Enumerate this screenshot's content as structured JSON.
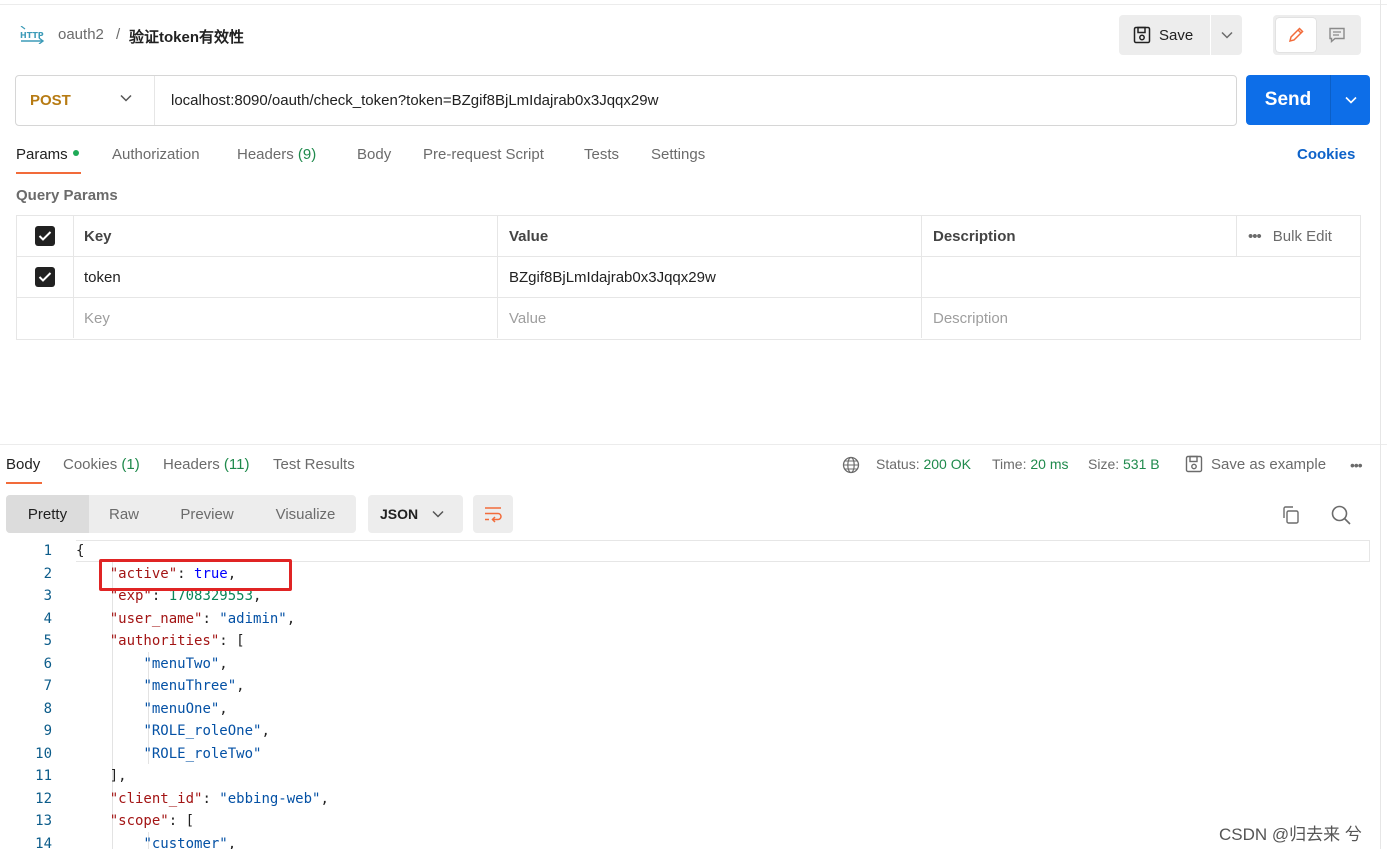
{
  "breadcrumb": {
    "collection": "oauth2",
    "separator": "/",
    "request_name": "验证token有效性"
  },
  "header": {
    "save_label": "Save"
  },
  "request": {
    "method": "POST",
    "url": "localhost:8090/oauth/check_token?token=BZgif8BjLmIdajrab0x3Jqqx29w",
    "send_label": "Send"
  },
  "req_tabs": {
    "params": "Params",
    "authorization": "Authorization",
    "headers": "Headers",
    "headers_count": "(9)",
    "body": "Body",
    "prerequest": "Pre-request Script",
    "tests": "Tests",
    "settings": "Settings",
    "cookies": "Cookies"
  },
  "query_params": {
    "title": "Query Params",
    "headers": {
      "key": "Key",
      "value": "Value",
      "description": "Description",
      "bulk_edit": "Bulk Edit"
    },
    "rows": [
      {
        "key": "token",
        "value": "BZgif8BjLmIdajrab0x3Jqqx29w",
        "description": ""
      }
    ],
    "placeholders": {
      "key": "Key",
      "value": "Value",
      "description": "Description"
    }
  },
  "response": {
    "tabs": {
      "body": "Body",
      "cookies": "Cookies",
      "cookies_count": "(1)",
      "headers": "Headers",
      "headers_count": "(11)",
      "test_results": "Test Results"
    },
    "status_label": "Status:",
    "status_value": "200 OK",
    "time_label": "Time:",
    "time_value": "20 ms",
    "size_label": "Size:",
    "size_value": "531 B",
    "save_example": "Save as example",
    "views": [
      "Pretty",
      "Raw",
      "Preview",
      "Visualize"
    ],
    "format": "JSON"
  },
  "code_lines": [
    {
      "n": "1",
      "t": "{"
    },
    {
      "n": "2",
      "t": "    \"active\": true,"
    },
    {
      "n": "3",
      "t": "    \"exp\": 1708329553,"
    },
    {
      "n": "4",
      "t": "    \"user_name\": \"adimin\","
    },
    {
      "n": "5",
      "t": "    \"authorities\": ["
    },
    {
      "n": "6",
      "t": "        \"menuTwo\","
    },
    {
      "n": "7",
      "t": "        \"menuThree\","
    },
    {
      "n": "8",
      "t": "        \"menuOne\","
    },
    {
      "n": "9",
      "t": "        \"ROLE_roleOne\","
    },
    {
      "n": "10",
      "t": "        \"ROLE_roleTwo\""
    },
    {
      "n": "11",
      "t": "    ],"
    },
    {
      "n": "12",
      "t": "    \"client_id\": \"ebbing-web\","
    },
    {
      "n": "13",
      "t": "    \"scope\": ["
    },
    {
      "n": "14",
      "t": "        \"customer\","
    }
  ],
  "watermark": "CSDN @归去来 兮",
  "colors": {
    "accent": "#f26b3a",
    "send": "#0d6ee8",
    "method": "#b77b13",
    "status_ok": "#1f8a4c",
    "highlight": "#e02424"
  }
}
